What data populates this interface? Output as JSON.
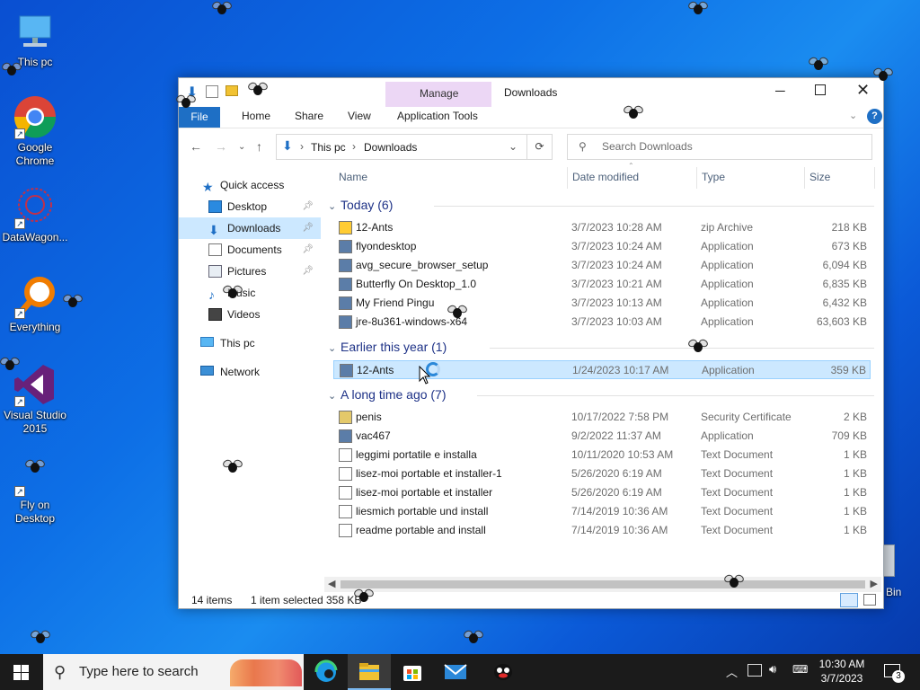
{
  "desktop": {
    "icons": [
      {
        "label": "This pc"
      },
      {
        "label": "Google Chrome"
      },
      {
        "label": "DataWagon..."
      },
      {
        "label": "Everything"
      },
      {
        "label": "Visual Studio 2015"
      },
      {
        "label": "Fly on Desktop"
      }
    ],
    "recycle_bin_label": "Bin"
  },
  "window": {
    "title": "Downloads",
    "ribbon": {
      "file": "File",
      "home": "Home",
      "share": "Share",
      "view": "View",
      "manage": "Manage",
      "app_tools": "Application Tools"
    },
    "address": {
      "this_pc": "This pc",
      "current": "Downloads"
    },
    "search_placeholder": "Search Downloads",
    "nav": {
      "quick_access": "Quick access",
      "desktop": "Desktop",
      "downloads": "Downloads",
      "documents": "Documents",
      "pictures": "Pictures",
      "music": "Music",
      "videos": "Videos",
      "this_pc": "This pc",
      "network": "Network"
    },
    "columns": {
      "name": "Name",
      "date": "Date modified",
      "type": "Type",
      "size": "Size"
    },
    "groups": [
      {
        "label": "Today (6)",
        "files": [
          {
            "name": "12-Ants",
            "date": "3/7/2023 10:28 AM",
            "type": "zip Archive",
            "size": "218 KB"
          },
          {
            "name": "flyondesktop",
            "date": "3/7/2023 10:24 AM",
            "type": "Application",
            "size": "673 KB"
          },
          {
            "name": "avg_secure_browser_setup",
            "date": "3/7/2023 10:24 AM",
            "type": "Application",
            "size": "6,094 KB"
          },
          {
            "name": "Butterfly On Desktop_1.0",
            "date": "3/7/2023 10:21 AM",
            "type": "Application",
            "size": "6,835 KB"
          },
          {
            "name": "My Friend Pingu",
            "date": "3/7/2023 10:13 AM",
            "type": "Application",
            "size": "6,432 KB"
          },
          {
            "name": "jre-8u361-windows-x64",
            "date": "3/7/2023 10:03 AM",
            "type": "Application",
            "size": "63,603 KB"
          }
        ]
      },
      {
        "label": "Earlier this year (1)",
        "files": [
          {
            "name": "12-Ants",
            "date": "1/24/2023 10:17 AM",
            "type": "Application",
            "size": "359 KB"
          }
        ]
      },
      {
        "label": "A long time ago (7)",
        "files": [
          {
            "name": "penis",
            "date": "10/17/2022 7:58 PM",
            "type": "Security Certificate",
            "size": "2 KB"
          },
          {
            "name": "vac467",
            "date": "9/2/2022 11:37 AM",
            "type": "Application",
            "size": "709 KB"
          },
          {
            "name": "leggimi portatile e installa",
            "date": "10/11/2020 10:53 AM",
            "type": "Text Document",
            "size": "1 KB"
          },
          {
            "name": "lisez-moi portable et installer-1",
            "date": "5/26/2020 6:19 AM",
            "type": "Text Document",
            "size": "1 KB"
          },
          {
            "name": "lisez-moi portable et installer",
            "date": "5/26/2020 6:19 AM",
            "type": "Text Document",
            "size": "1 KB"
          },
          {
            "name": "liesmich portable und install",
            "date": "7/14/2019 10:36 AM",
            "type": "Text Document",
            "size": "1 KB"
          },
          {
            "name": "readme portable and install",
            "date": "7/14/2019 10:36 AM",
            "type": "Text Document",
            "size": "1 KB"
          }
        ]
      }
    ],
    "status": {
      "items": "14 items",
      "selected": "1 item selected",
      "size": "358 KB"
    }
  },
  "taskbar": {
    "search_placeholder": "Type here to search",
    "time": "10:30 AM",
    "date": "3/7/2023",
    "notification_count": "3"
  }
}
